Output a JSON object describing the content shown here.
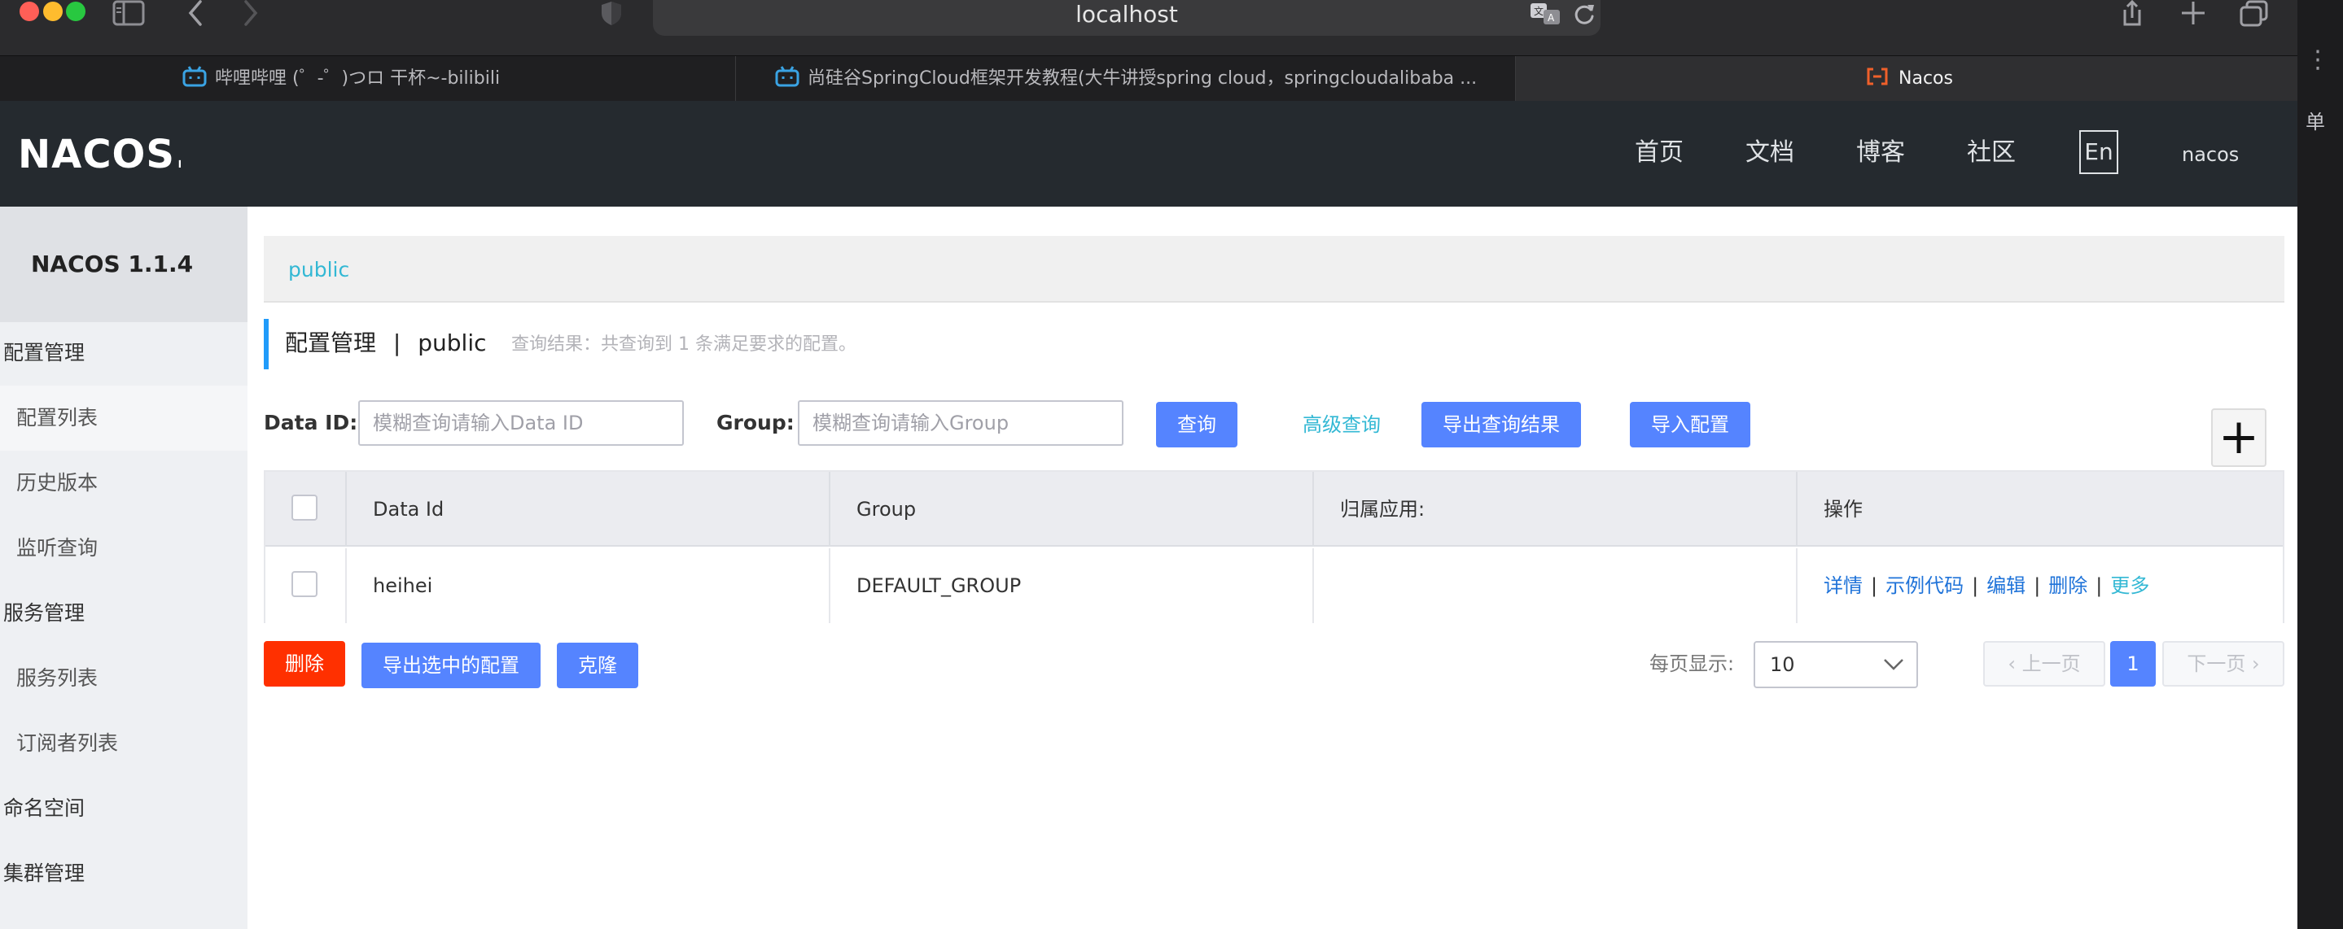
{
  "window": {
    "address": "localhost",
    "colors": {
      "close": "#ff5f57",
      "minimize": "#febc2e",
      "zoom": "#28c840"
    }
  },
  "tabs": [
    {
      "label": "哔哩哔哩 (゜-゜)つロ 干杯~-bilibili",
      "icon": "bilibili-icon"
    },
    {
      "label": "尚硅谷SpringCloud框架开发教程(大牛讲授spring cloud，springcloudalibaba ...",
      "icon": "bilibili-icon"
    },
    {
      "label": "Nacos",
      "icon": "nacos-icon"
    }
  ],
  "header": {
    "logo": "NACOS.",
    "nav": [
      "首页",
      "文档",
      "博客",
      "社区"
    ],
    "lang": "En",
    "user": "nacos"
  },
  "sidebar": {
    "title": "NACOS 1.1.4",
    "groups": [
      {
        "label": "配置管理",
        "items": [
          "配置列表",
          "历史版本",
          "监听查询"
        ]
      },
      {
        "label": "服务管理",
        "items": [
          "服务列表",
          "订阅者列表"
        ]
      },
      {
        "label": "命名空间",
        "items": []
      },
      {
        "label": "集群管理",
        "items": []
      }
    ]
  },
  "main": {
    "namespace": "public",
    "title": "配置管理",
    "title_sep": "|",
    "title_ns": "public",
    "query_result": "查询结果：共查询到 1 条满足要求的配置。",
    "filters": {
      "dataid_label": "Data ID:",
      "dataid_placeholder": "模糊查询请输入Data ID",
      "group_label": "Group:",
      "group_placeholder": "模糊查询请输入Group"
    },
    "buttons": {
      "search": "查询",
      "advanced": "高级查询",
      "export_result": "导出查询结果",
      "import": "导入配置",
      "add": "+"
    },
    "table": {
      "columns": [
        "Data Id",
        "Group",
        "归属应用:",
        "操作"
      ],
      "rows": [
        {
          "data_id": "heihei",
          "group": "DEFAULT_GROUP",
          "app": ""
        }
      ],
      "ops": [
        "详情",
        "示例代码",
        "编辑",
        "删除"
      ],
      "op_more": "更多",
      "op_sep": "|"
    },
    "bottom": {
      "delete": "删除",
      "export_selected": "导出选中的配置",
      "clone": "克隆",
      "page_size_label": "每页显示:",
      "page_size": "10",
      "prev": "上一页",
      "page": "1",
      "next": "下一页"
    }
  },
  "right_strip": {
    "char": "单"
  }
}
